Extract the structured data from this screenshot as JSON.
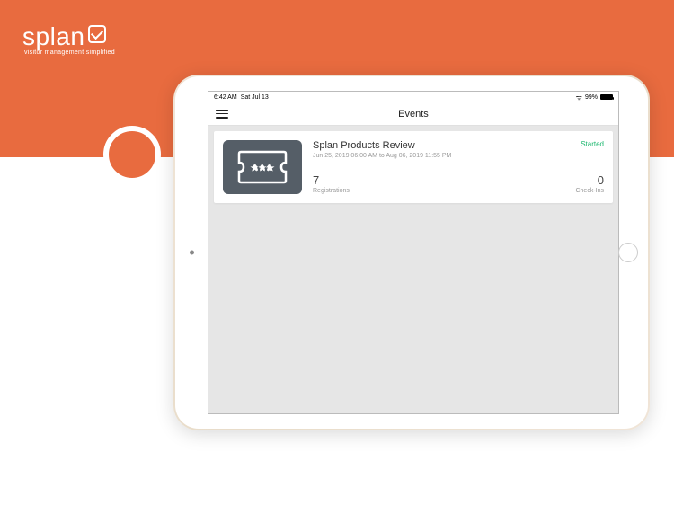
{
  "brand": {
    "name": "splan",
    "tagline": "visitor management simplified"
  },
  "statusBar": {
    "time": "6:42 AM",
    "date": "Sat Jul 13",
    "battery": "99%"
  },
  "nav": {
    "title": "Events"
  },
  "event": {
    "title": "Splan Products Review",
    "status": "Started",
    "dateRange": "Jun 25, 2019 06:00 AM  to  Aug 06, 2019 11:55 PM",
    "registrations": {
      "value": "7",
      "label": "Registrations"
    },
    "checkins": {
      "value": "0",
      "label": "Check-Ins"
    }
  }
}
